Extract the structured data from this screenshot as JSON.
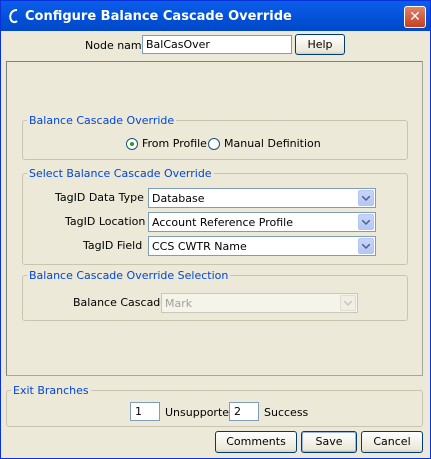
{
  "window": {
    "title": "Configure Balance Cascade Override"
  },
  "node": {
    "label": "Node name",
    "value": "BalCasOver",
    "help_label": "Help"
  },
  "override_group": {
    "title": "Balance Cascade Override",
    "options": [
      "From Profile",
      "Manual Definition"
    ],
    "selected": "From Profile"
  },
  "select_group": {
    "title": "Select Balance Cascade Override",
    "data_type_label": "TagID Data Type",
    "data_type_value": "Database",
    "location_label": "TagID Location",
    "location_value": "Account Reference Profile",
    "field_label": "TagID Field",
    "field_value": "CCS CWTR Name"
  },
  "selection_group": {
    "title": "Balance Cascade Override Selection",
    "cascade_label": "Balance Cascade",
    "cascade_value": "Mark"
  },
  "exit": {
    "title": "Exit Branches",
    "branches": [
      {
        "number": "1",
        "label": "Unsupported"
      },
      {
        "number": "2",
        "label": "Success"
      }
    ]
  },
  "buttons": {
    "comments": "Comments",
    "save": "Save",
    "cancel": "Cancel"
  },
  "colors": {
    "title_bar": "#0048c8",
    "group_title": "#0046d5",
    "background": "#ece9d8"
  }
}
